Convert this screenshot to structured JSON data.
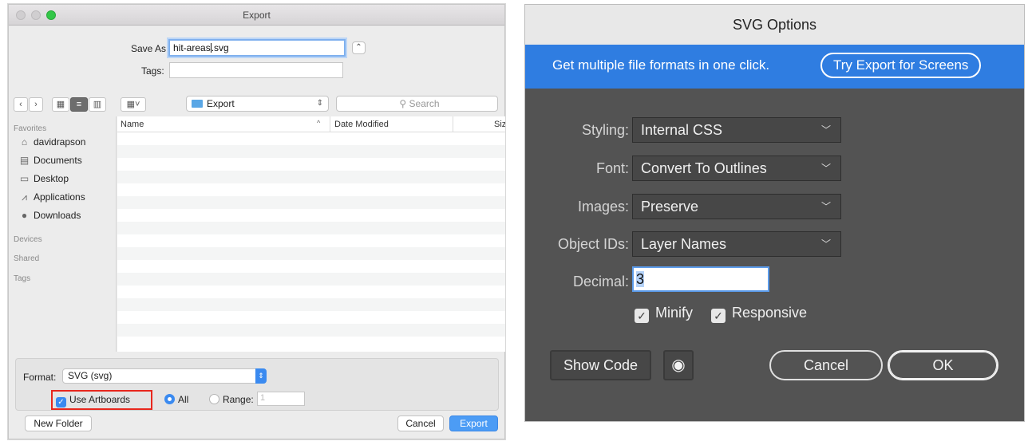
{
  "export_dialog": {
    "title": "Export",
    "save_as_label": "Save As:",
    "save_as_value_before": "hit-areas",
    "save_as_value_after": ".svg",
    "tags_label": "Tags:",
    "tags_value": "",
    "expand_glyph": "⌃",
    "location": "Export",
    "search_placeholder": "Search",
    "sidebar": {
      "favorites_label": "Favorites",
      "favorites": [
        {
          "label": "davidrapson",
          "icon": "home-icon"
        },
        {
          "label": "Documents",
          "icon": "documents-icon"
        },
        {
          "label": "Desktop",
          "icon": "desktop-icon"
        },
        {
          "label": "Applications",
          "icon": "applications-icon"
        },
        {
          "label": "Downloads",
          "icon": "downloads-icon"
        }
      ],
      "devices_label": "Devices",
      "shared_label": "Shared",
      "tags_label": "Tags"
    },
    "columns": {
      "name": "Name",
      "date_modified": "Date Modified",
      "size": "Siz"
    },
    "format_label": "Format:",
    "format_value": "SVG (svg)",
    "use_artboards_label": "Use Artboards",
    "all_label": "All",
    "range_label": "Range:",
    "range_placeholder": "1",
    "new_folder_label": "New Folder",
    "cancel_label": "Cancel",
    "export_label": "Export",
    "highlight_color": "#e8271d"
  },
  "svg_options": {
    "title": "SVG Options",
    "banner_text": "Get multiple file formats in one click.",
    "banner_button": "Try Export for Screens",
    "styling_label": "Styling:",
    "styling_value": "Internal CSS",
    "font_label": "Font:",
    "font_value": "Convert To Outlines",
    "images_label": "Images:",
    "images_value": "Preserve",
    "object_ids_label": "Object IDs:",
    "object_ids_value": "Layer Names",
    "decimal_label": "Decimal:",
    "decimal_value": "3",
    "minify_label": "Minify",
    "responsive_label": "Responsive",
    "show_code_label": "Show Code",
    "cancel_label": "Cancel",
    "ok_label": "OK",
    "banner_color": "#2f7de1"
  }
}
